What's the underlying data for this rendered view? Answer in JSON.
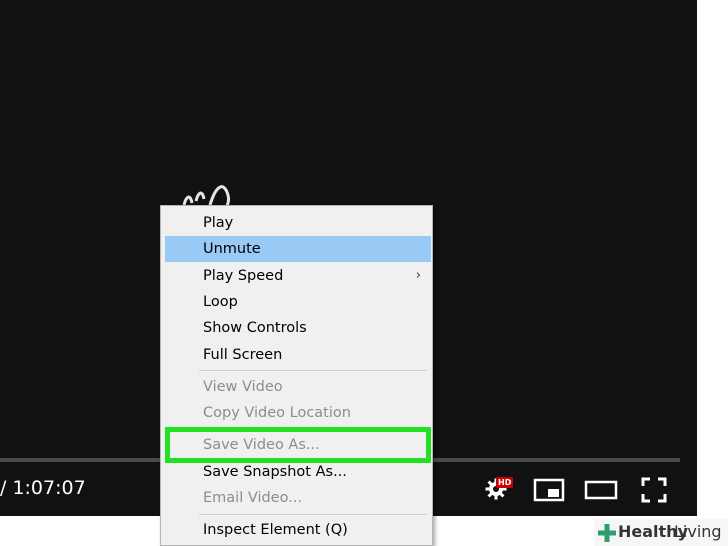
{
  "player": {
    "time": "/ 1:07:07",
    "hd_badge": "HD",
    "icons": [
      "settings-gear-icon",
      "miniplayer-icon",
      "theater-mode-icon",
      "fullscreen-icon"
    ]
  },
  "context_menu": {
    "items": [
      {
        "label": "Play",
        "state": "enabled"
      },
      {
        "label": "Unmute",
        "state": "highlighted"
      },
      {
        "label": "Play Speed",
        "state": "enabled",
        "submenu": true
      },
      {
        "label": "Loop",
        "state": "enabled"
      },
      {
        "label": "Show Controls",
        "state": "enabled"
      },
      {
        "label": "Full Screen",
        "state": "enabled"
      },
      {
        "label": "View Video",
        "state": "disabled"
      },
      {
        "label": "Copy Video Location",
        "state": "disabled"
      },
      {
        "label": "Save Video As...",
        "state": "disabled",
        "outlined": true
      },
      {
        "label": "Save Snapshot As...",
        "state": "enabled"
      },
      {
        "label": "Email Video...",
        "state": "disabled"
      },
      {
        "label": "Inspect Element (Q)",
        "state": "enabled"
      }
    ],
    "submenu_arrow": "›",
    "colors": {
      "highlight": "#99c9f5",
      "outline": "#22e023",
      "disabled_text": "#8d8d8d"
    }
  },
  "watermark": {
    "word1": "Healthy",
    "word2": "Living",
    "icon": "plus-cross-icon",
    "color": "#2f9e6e"
  }
}
